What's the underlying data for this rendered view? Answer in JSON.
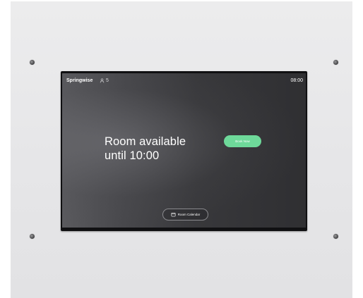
{
  "device": {
    "brand": "Springwise",
    "people_count": "5",
    "time": "08:00"
  },
  "status": {
    "line1": "Room available",
    "line2": "until 10:00"
  },
  "actions": {
    "book_now": "Book Now",
    "room_calendar": "Room Calendar"
  },
  "icons": {
    "people": "person-icon",
    "calendar": "calendar-icon"
  },
  "colors": {
    "accent": "#6ed99a",
    "screen_bg": "#3a3a3d",
    "wall_plate": "#e8e8ea"
  }
}
